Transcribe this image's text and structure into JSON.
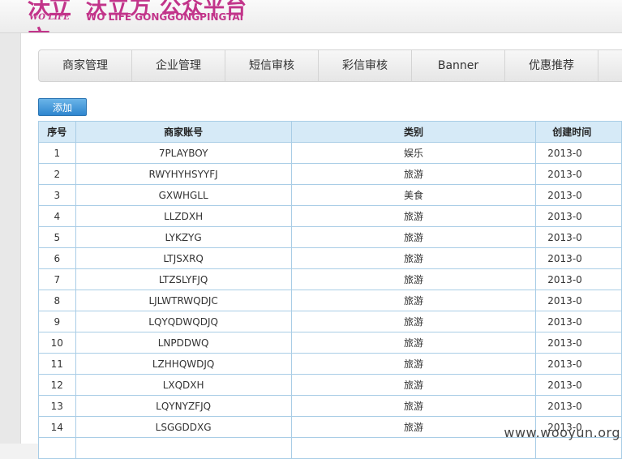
{
  "brand": {
    "logo_big": "沃立方",
    "logo_small": "WO LIFE",
    "title": "沃立方 公众平台",
    "subtitle": "WO LIFE GONGGONGPINGTAI"
  },
  "tabs": [
    {
      "label": "商家管理"
    },
    {
      "label": "企业管理"
    },
    {
      "label": "短信审核"
    },
    {
      "label": "彩信审核"
    },
    {
      "label": "Banner"
    },
    {
      "label": "优惠推荐"
    }
  ],
  "add_button": "添加",
  "table": {
    "headers": {
      "no": "序号",
      "account": "商家账号",
      "category": "类别",
      "created": "创建时间"
    },
    "rows": [
      {
        "no": "1",
        "account": "7PLAYBOY",
        "category": "娱乐",
        "created": "2013-0"
      },
      {
        "no": "2",
        "account": "RWYHYHSYYFJ",
        "category": "旅游",
        "created": "2013-0"
      },
      {
        "no": "3",
        "account": "GXWHGLL",
        "category": "美食",
        "created": "2013-0"
      },
      {
        "no": "4",
        "account": "LLZDXH",
        "category": "旅游",
        "created": "2013-0"
      },
      {
        "no": "5",
        "account": "LYKZYG",
        "category": "旅游",
        "created": "2013-0"
      },
      {
        "no": "6",
        "account": "LTJSXRQ",
        "category": "旅游",
        "created": "2013-0"
      },
      {
        "no": "7",
        "account": "LTZSLYFJQ",
        "category": "旅游",
        "created": "2013-0"
      },
      {
        "no": "8",
        "account": "LJLWTRWQDJC",
        "category": "旅游",
        "created": "2013-0"
      },
      {
        "no": "9",
        "account": "LQYQDWQDJQ",
        "category": "旅游",
        "created": "2013-0"
      },
      {
        "no": "10",
        "account": "LNPDDWQ",
        "category": "旅游",
        "created": "2013-0"
      },
      {
        "no": "11",
        "account": "LZHHQWDJQ",
        "category": "旅游",
        "created": "2013-0"
      },
      {
        "no": "12",
        "account": "LXQDXH",
        "category": "旅游",
        "created": "2013-0"
      },
      {
        "no": "13",
        "account": "LQYNYZFJQ",
        "category": "旅游",
        "created": "2013-0"
      },
      {
        "no": "14",
        "account": "LSGGDDXG",
        "category": "旅游",
        "created": "2013-0"
      },
      {
        "no": "",
        "account": "",
        "category": "",
        "created": ""
      }
    ]
  },
  "watermark": "www.wooyun.org"
}
